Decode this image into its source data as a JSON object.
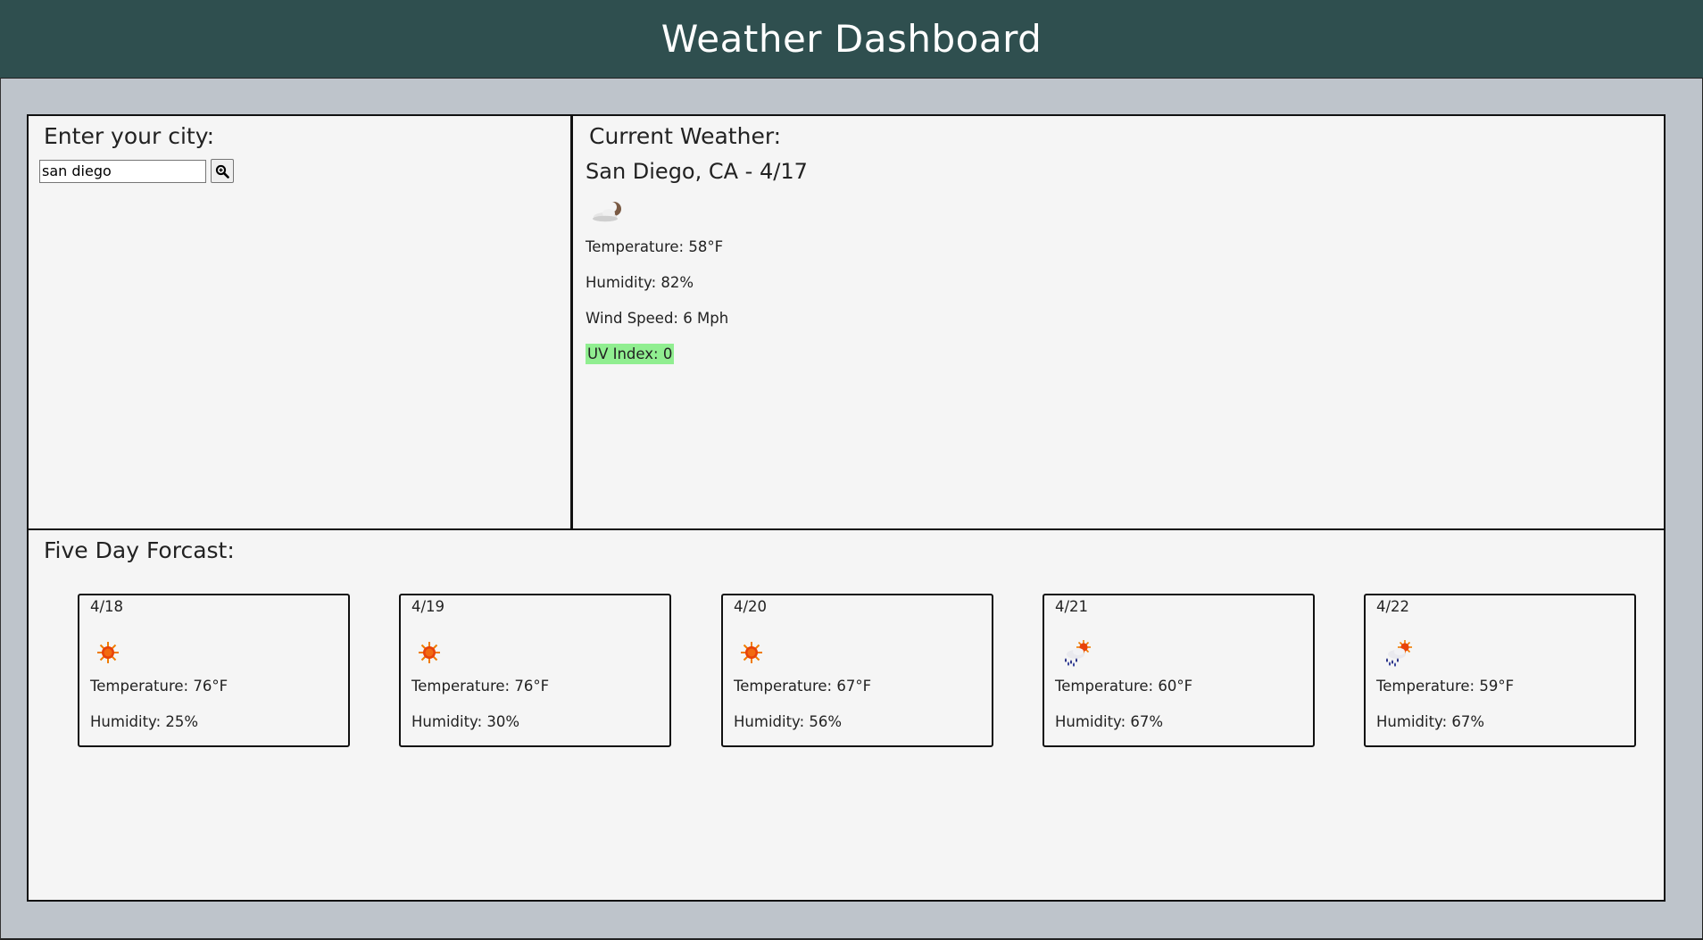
{
  "header": {
    "title": "Weather Dashboard"
  },
  "search": {
    "title": "Enter your city:",
    "value": "san diego",
    "button_icon": "search-icon"
  },
  "current": {
    "title": "Current Weather:",
    "city_date": "San Diego, CA - 4/17",
    "icon": "partly-cloudy-night-icon",
    "temperature": "Temperature: 58°F",
    "humidity": "Humidity: 82%",
    "wind": "Wind Speed: 6 Mph",
    "uv": "UV Index: 0",
    "uv_color": "#90ee90"
  },
  "forecast": {
    "title": "Five Day Forcast:",
    "days": [
      {
        "date": "4/18",
        "icon": "sun-icon",
        "temperature": "Temperature: 76°F",
        "humidity": "Humidity: 25%"
      },
      {
        "date": "4/19",
        "icon": "sun-icon",
        "temperature": "Temperature: 76°F",
        "humidity": "Humidity: 30%"
      },
      {
        "date": "4/20",
        "icon": "sun-icon",
        "temperature": "Temperature: 67°F",
        "humidity": "Humidity: 56%"
      },
      {
        "date": "4/21",
        "icon": "sun-rain-icon",
        "temperature": "Temperature: 60°F",
        "humidity": "Humidity: 67%"
      },
      {
        "date": "4/22",
        "icon": "sun-rain-icon",
        "temperature": "Temperature: 59°F",
        "humidity": "Humidity: 67%"
      }
    ]
  },
  "colors": {
    "header_bg": "#2f4f4f",
    "page_bg": "#bec4cb",
    "panel_bg": "#f5f5f5"
  }
}
